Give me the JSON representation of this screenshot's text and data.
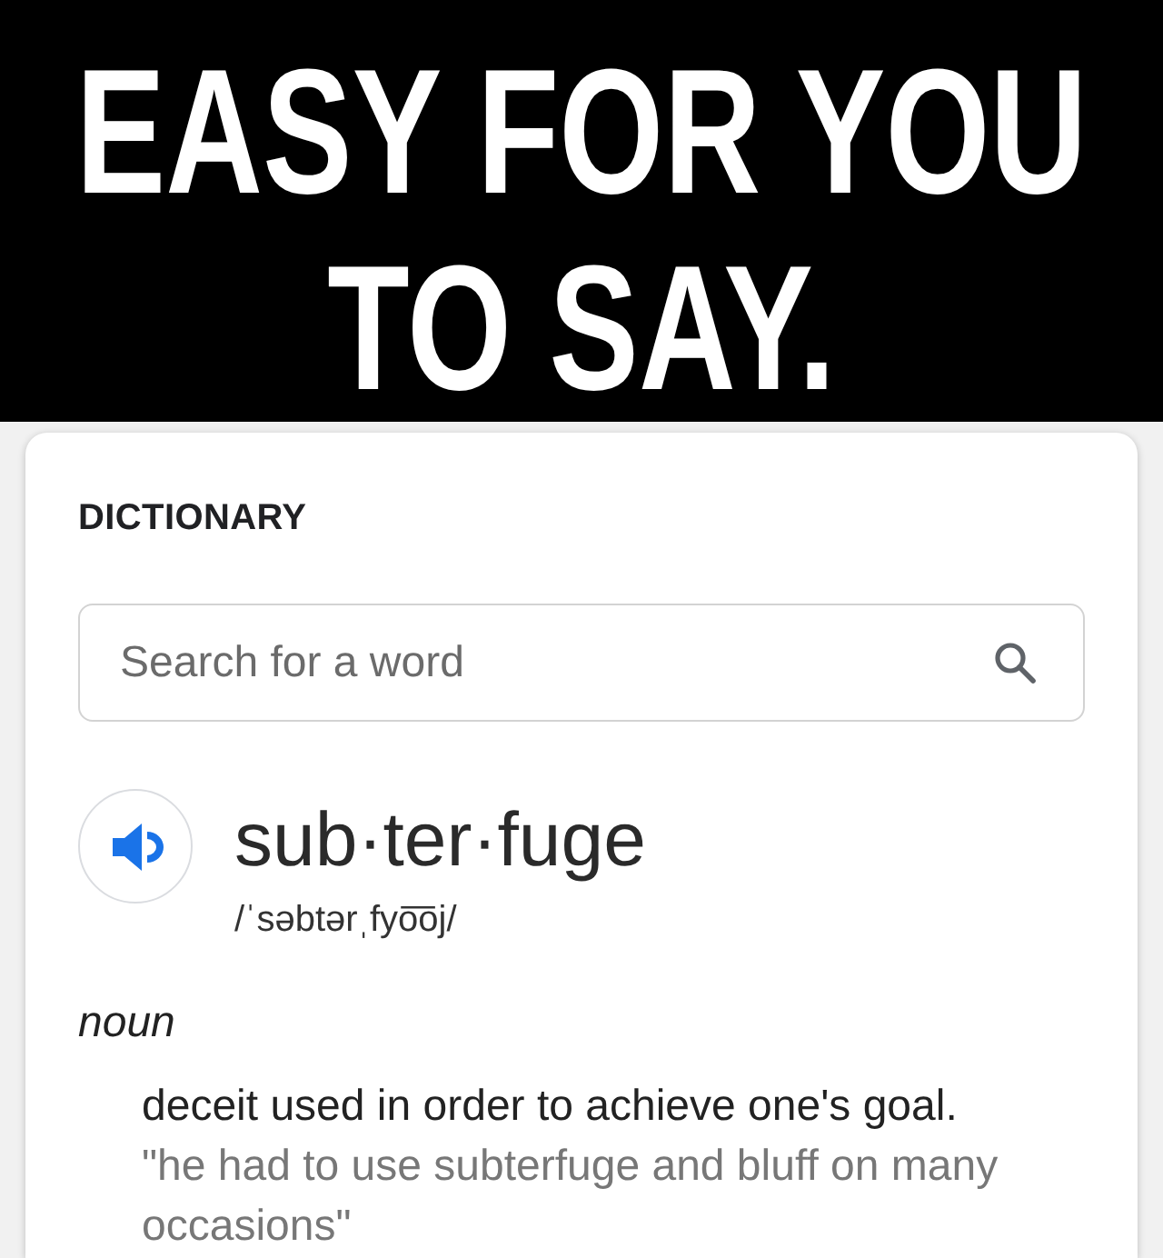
{
  "banner": {
    "title": "EASY FOR YOU TO SAY."
  },
  "dictionary": {
    "heading": "DICTIONARY",
    "search": {
      "placeholder": "Search for a word"
    },
    "entry": {
      "word": "sub·ter·fuge",
      "pronunciation": "/ˈsəbtərˌfyo͞oj/",
      "part_of_speech": "noun",
      "definitions": [
        {
          "text": "deceit used in order to achieve one's goal.",
          "example": "\"he had to use subterfuge and bluff on many occasions\""
        }
      ]
    }
  }
}
